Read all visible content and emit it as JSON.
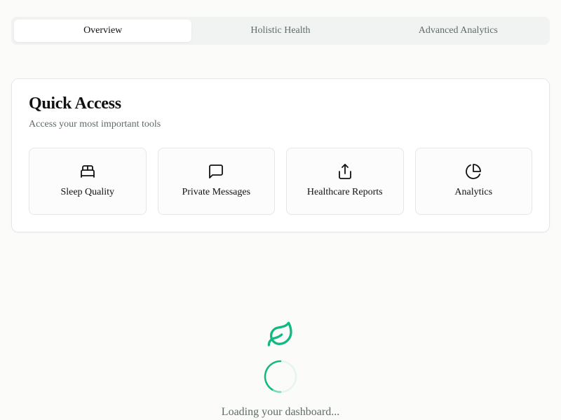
{
  "tabs": [
    {
      "label": "Overview",
      "active": true
    },
    {
      "label": "Holistic Health",
      "active": false
    },
    {
      "label": "Advanced Analytics",
      "active": false
    }
  ],
  "quick_access": {
    "title": "Quick Access",
    "subtitle": "Access your most important tools",
    "items": [
      {
        "label": "Sleep Quality",
        "icon": "bed-icon"
      },
      {
        "label": "Private Messages",
        "icon": "message-square-icon"
      },
      {
        "label": "Healthcare Reports",
        "icon": "share-upload-icon"
      },
      {
        "label": "Analytics",
        "icon": "pie-chart-icon"
      }
    ]
  },
  "loading": {
    "text": "Loading your dashboard...",
    "icon": "leaf-icon",
    "accent_color": "#10b981"
  }
}
